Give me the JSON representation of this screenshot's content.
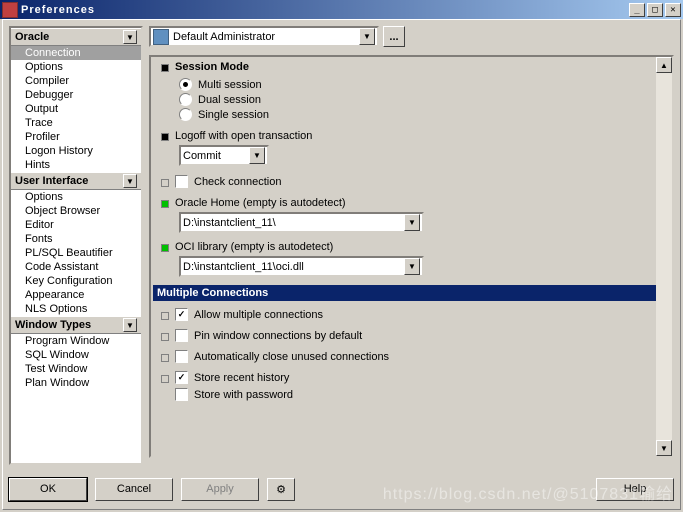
{
  "window": {
    "title": "Preferences"
  },
  "sidebar": {
    "categories": [
      {
        "name": "Oracle",
        "items": [
          "Connection",
          "Options",
          "Compiler",
          "Debugger",
          "Output",
          "Trace",
          "Profiler",
          "Logon History",
          "Hints"
        ],
        "selected": "Connection"
      },
      {
        "name": "User Interface",
        "items": [
          "Options",
          "Object Browser",
          "Editor",
          "Fonts",
          "PL/SQL Beautifier",
          "Code Assistant",
          "Key Configuration",
          "Appearance",
          "NLS Options"
        ]
      },
      {
        "name": "Window Types",
        "items": [
          "Program Window",
          "SQL Window",
          "Test Window",
          "Plan Window"
        ]
      }
    ]
  },
  "profile": {
    "selected": "Default Administrator",
    "more": "..."
  },
  "session_mode": {
    "label": "Session Mode",
    "options": [
      "Multi session",
      "Dual session",
      "Single session"
    ],
    "selected": "Multi session"
  },
  "logoff": {
    "label": "Logoff with open transaction",
    "value": "Commit"
  },
  "check_connection": {
    "label": "Check connection",
    "checked": false
  },
  "oracle_home": {
    "label": "Oracle Home (empty is autodetect)",
    "value": "D:\\instantclient_11\\"
  },
  "oci_library": {
    "label": "OCI library (empty is autodetect)",
    "value": "D:\\instantclient_11\\oci.dll"
  },
  "multiple_connections": {
    "header": "Multiple Connections",
    "allow": {
      "label": "Allow multiple connections",
      "checked": true
    },
    "pin": {
      "label": "Pin window connections by default",
      "checked": false
    },
    "auto": {
      "label": "Automatically close unused connections",
      "checked": false
    },
    "store": {
      "label": "Store recent history",
      "checked": true
    },
    "storepw": {
      "label": "Store with password",
      "checked": false
    }
  },
  "footer": {
    "ok": "OK",
    "cancel": "Cancel",
    "apply": "Apply",
    "help": "Help"
  },
  "watermark": "https://blog.csdn.net/@5107831输给"
}
